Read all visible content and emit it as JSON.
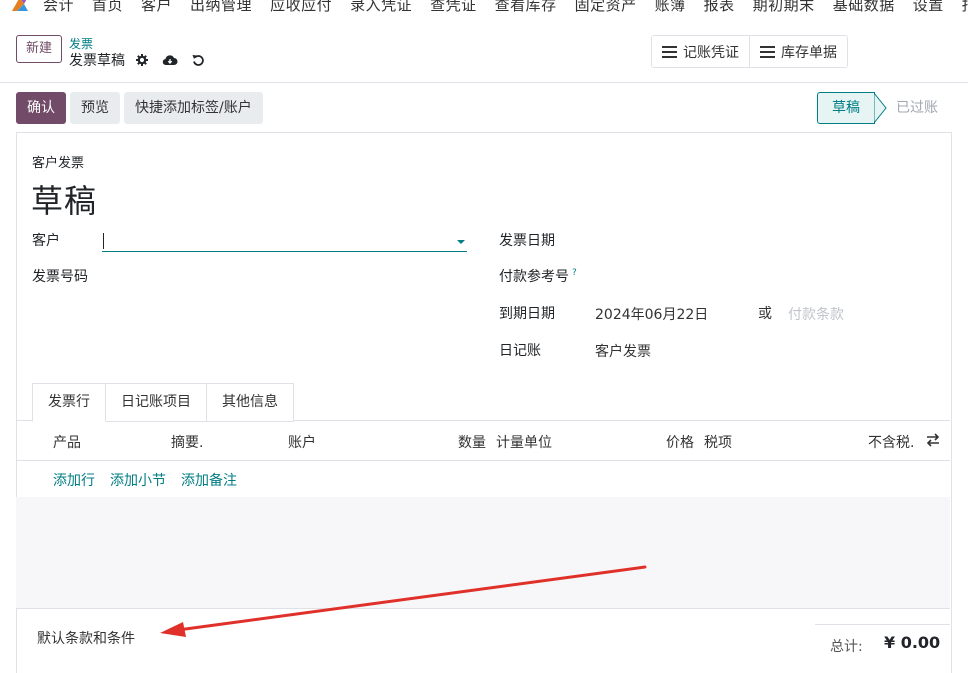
{
  "nav": {
    "app": "会计",
    "items": [
      "首页",
      "客户",
      "出纳管理",
      "应收应付",
      "录入凭证",
      "查凭证",
      "查看库存",
      "固定资产",
      "账簿",
      "报表",
      "期初期末",
      "基础数据",
      "设置",
      "报告"
    ]
  },
  "control_panel": {
    "new_label": "新建",
    "breadcrumb_parent": "发票",
    "breadcrumb_current": "发票草稿",
    "smart_buttons": [
      "记账凭证",
      "库存单据"
    ]
  },
  "actions": {
    "confirm": "确认",
    "preview": "预览",
    "quick_add": "快捷添加标签/账户"
  },
  "status": {
    "draft": "草稿",
    "posted": "已过账"
  },
  "form": {
    "type_label": "客户发票",
    "title": "草稿",
    "customer_label": "客户",
    "invoice_number_label": "发票号码",
    "invoice_date_label": "发票日期",
    "payment_ref_label": "付款参考号",
    "payment_ref_help": "?",
    "due_date_label": "到期日期",
    "due_date_value": "2024年06月22日",
    "or_label": "或",
    "payment_terms_placeholder": "付款条款",
    "journal_label": "日记账",
    "journal_value": "客户发票"
  },
  "tabs": [
    "发票行",
    "日记账项目",
    "其他信息"
  ],
  "lines_table": {
    "columns": {
      "product": "产品",
      "label": "摘要.",
      "account": "账户",
      "quantity": "数量",
      "uom": "计量单位",
      "price": "价格",
      "taxes": "税项",
      "subtotal": "不含税."
    },
    "add_line": "添加行",
    "add_section": "添加小节",
    "add_note": "添加备注"
  },
  "footer": {
    "terms": "默认条款和条件",
    "total_label": "总计:",
    "total_value": "¥ 0.00"
  },
  "colors": {
    "brand": "#714b67",
    "accent": "#017e84",
    "annotation_arrow": "#e0302a"
  }
}
